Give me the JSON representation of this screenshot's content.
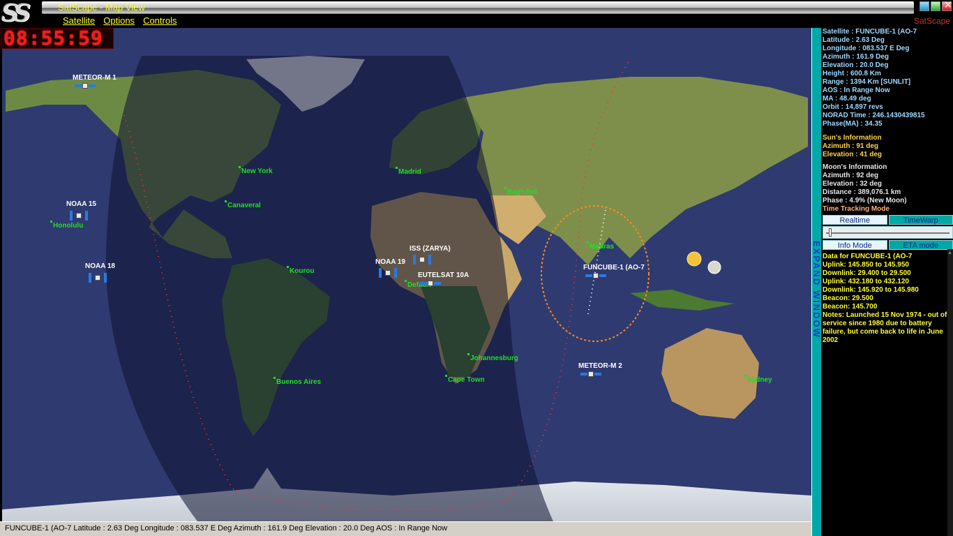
{
  "app": {
    "title": "SatScape - Map View",
    "logo": "SS",
    "brand": "SatScape",
    "menu": [
      "Satellite",
      "Options",
      "Controls"
    ]
  },
  "clock": "08:55:59",
  "cities": [
    {
      "name": "New York"
    },
    {
      "name": "Canaveral"
    },
    {
      "name": "Honolulu"
    },
    {
      "name": "Kourou"
    },
    {
      "name": "Buenos Aires"
    },
    {
      "name": "Madrid"
    },
    {
      "name": "Baghdad"
    },
    {
      "name": "Default"
    },
    {
      "name": "Johannesburg"
    },
    {
      "name": "Cape Town"
    },
    {
      "name": "Madras"
    },
    {
      "name": "Sydney"
    }
  ],
  "satellites": [
    {
      "name": "METEOR-M 1"
    },
    {
      "name": "NOAA 15"
    },
    {
      "name": "NOAA 18"
    },
    {
      "name": "NOAA 19"
    },
    {
      "name": "ISS (ZARYA)"
    },
    {
      "name": "EUTELSAT 10A"
    },
    {
      "name": "FUNCUBE-1 (AO-7"
    },
    {
      "name": "METEOR-M 2"
    }
  ],
  "panel": {
    "satellite": "Satellite : FUNCUBE-1 (AO-7",
    "latitude": "Latitude : 2.63 Deg",
    "longitude": "Longitude : 083.537 E Deg",
    "azimuth": "Azimuth : 161.9 Deg",
    "elevation": "Elevation : 20.0 Deg",
    "height": "Height : 600.8 Km",
    "range": "Range : 1394 Km  [SUNLIT]",
    "aos": "AOS : In Range Now",
    "ma": "MA : 48.49 deg",
    "orbit": "Orbit : 14,897 revs",
    "norad": "NORAD Time : 246.1430439815",
    "phase": "Phase(MA) : 34.35",
    "sun_title": "Sun's Information",
    "sun_az": "Azimuth : 91 deg",
    "sun_el": "Elevation : 41 deg",
    "moon_title": "Moon's Information",
    "moon_az": "Azimuth : 92 deg",
    "moon_el": "Elevation : 32 deg",
    "moon_dist": "Distance : 389,076.1 km",
    "moon_phase": "Phase : 4.9% (New Moon)",
    "tt_title": "Time Tracking Mode",
    "btn_realtime": "Realtime",
    "btn_timewarp": "TimeWarp",
    "btn_info": "Info Mode",
    "btn_eta": "ETA mode",
    "data_title": "Data for FUNCUBE-1 (AO-7",
    "uplink1": "Uplink: 145.850 to 145.950",
    "downlink1": "Downlink: 29.400 to 29.500",
    "uplink2": "Uplink: 432.180 to 432.120",
    "downlink2": "Downlink: 145.920 to 145.980",
    "beacon1": "Beacon: 29.500",
    "beacon2": "Beacon: 145.700",
    "notes": "Notes: Launched 15 Nov 1974 - out of service since 1980 due to battery failure, but come back to life in June 2002"
  },
  "expand_label": "EXPAND WINDOW",
  "status": "FUNCUBE-1 (AO-7  Latitude : 2.63 Deg  Longitude : 083.537 E Deg  Azimuth : 161.9 Deg  Elevation : 20.0 Deg  AOS : In Range Now",
  "colors": {
    "menu_text": "#ffff33",
    "city_text": "#20e020",
    "panel_text": "#9fd8ff",
    "clock": "#ff1a1a",
    "footprint": "#ff8a1a",
    "ground_track": "#ff3030"
  }
}
